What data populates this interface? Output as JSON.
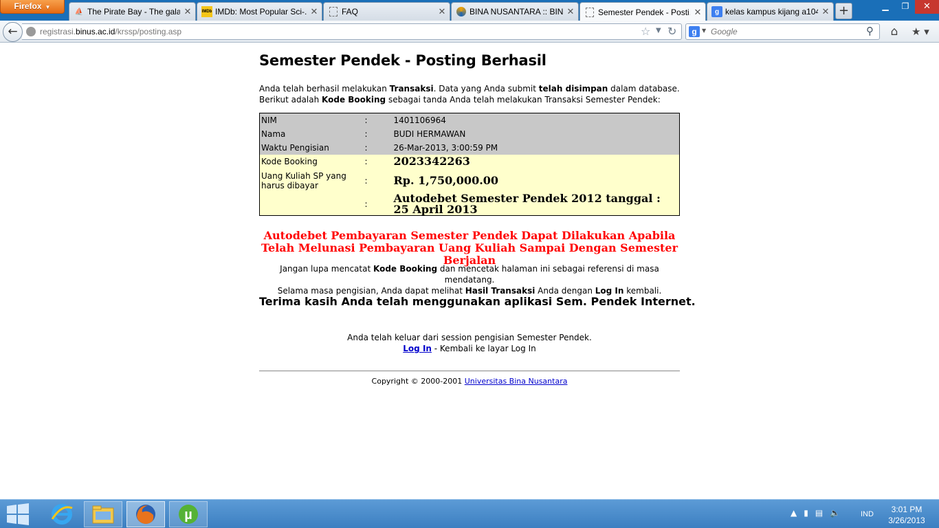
{
  "browser": {
    "menu_button": "Firefox",
    "tabs": [
      {
        "label": "The Pirate Bay - The gala...",
        "icon": "pirate-ship-icon"
      },
      {
        "label": "IMDb: Most Popular Sci-...",
        "icon": "imdb-icon",
        "icon_text": "IMDb"
      },
      {
        "label": "FAQ",
        "icon": "blank-page-icon"
      },
      {
        "label": "BINA NUSANTARA :: BIN...",
        "icon": "binus-icon"
      },
      {
        "label": "Semester Pendek - Posti...",
        "icon": "blank-page-icon",
        "active": true
      },
      {
        "label": "kelas kampus kijang a104...",
        "icon": "google-icon",
        "icon_text": "g"
      }
    ],
    "url_prefix": "registrasi.",
    "url_domain": "binus.ac.id",
    "url_path": "/krssp/posting.asp",
    "search_placeholder": "Google",
    "search_engine_letter": "g"
  },
  "page": {
    "title": "Semester Pendek - Posting Berhasil",
    "intro": {
      "t1": "Anda telah berhasil melakukan ",
      "b1": "Transaksi",
      "t2": ". Data yang Anda submit ",
      "b2": "telah disimpan",
      "t3": " dalam database.",
      "t4": "Berikut adalah ",
      "b3": "Kode Booking",
      "t5": " sebagai tanda Anda telah melakukan Transaksi Semester Pendek:"
    },
    "table": {
      "separator": ":",
      "rows": [
        {
          "label": "NIM",
          "value": "1401106964"
        },
        {
          "label": "Nama",
          "value": "BUDI HERMAWAN"
        },
        {
          "label": "Waktu Pengisian",
          "value": "26-Mar-2013, 3:00:59 PM"
        },
        {
          "label": "Kode Booking",
          "value": "2023342263"
        },
        {
          "label": "Uang Kuliah SP yang harus dibayar",
          "value": "Rp. 1,750,000.00"
        },
        {
          "label": "",
          "value": "Autodebet Semester Pendek 2012 tanggal : 25 April 2013"
        }
      ]
    },
    "warning": "Autodebet Pembayaran Semester Pendek Dapat Dilakukan Apabila Telah Melunasi Pembayaran Uang Kuliah Sampai Dengan Semester Berjalan",
    "reminder": {
      "t1": "Jangan lupa mencatat ",
      "b1": "Kode Booking",
      "t2": " dan mencetak halaman ini sebagai referensi di masa mendatang.",
      "t3": "Selama masa pengisian, Anda dapat melihat ",
      "b2": "Hasil Transaksi",
      "t4": " Anda dengan ",
      "b3": "Log In",
      "t5": " kembali."
    },
    "thanks": "Terima kasih Anda telah menggunakan aplikasi Sem. Pendek Internet.",
    "logout_text": "Anda telah keluar dari session pengisian Semester Pendek.",
    "login_link": "Log In",
    "login_suffix": " - Kembali ke layar Log In",
    "copyright_text": "Copyright © 2000-2001 ",
    "copyright_link": "Universitas Bina Nusantara"
  },
  "taskbar": {
    "apps": [
      "internet-explorer-icon",
      "file-explorer-icon",
      "firefox-icon",
      "utorrent-icon"
    ],
    "language": "IND",
    "time": "3:01 PM",
    "date": "3/26/2013"
  }
}
